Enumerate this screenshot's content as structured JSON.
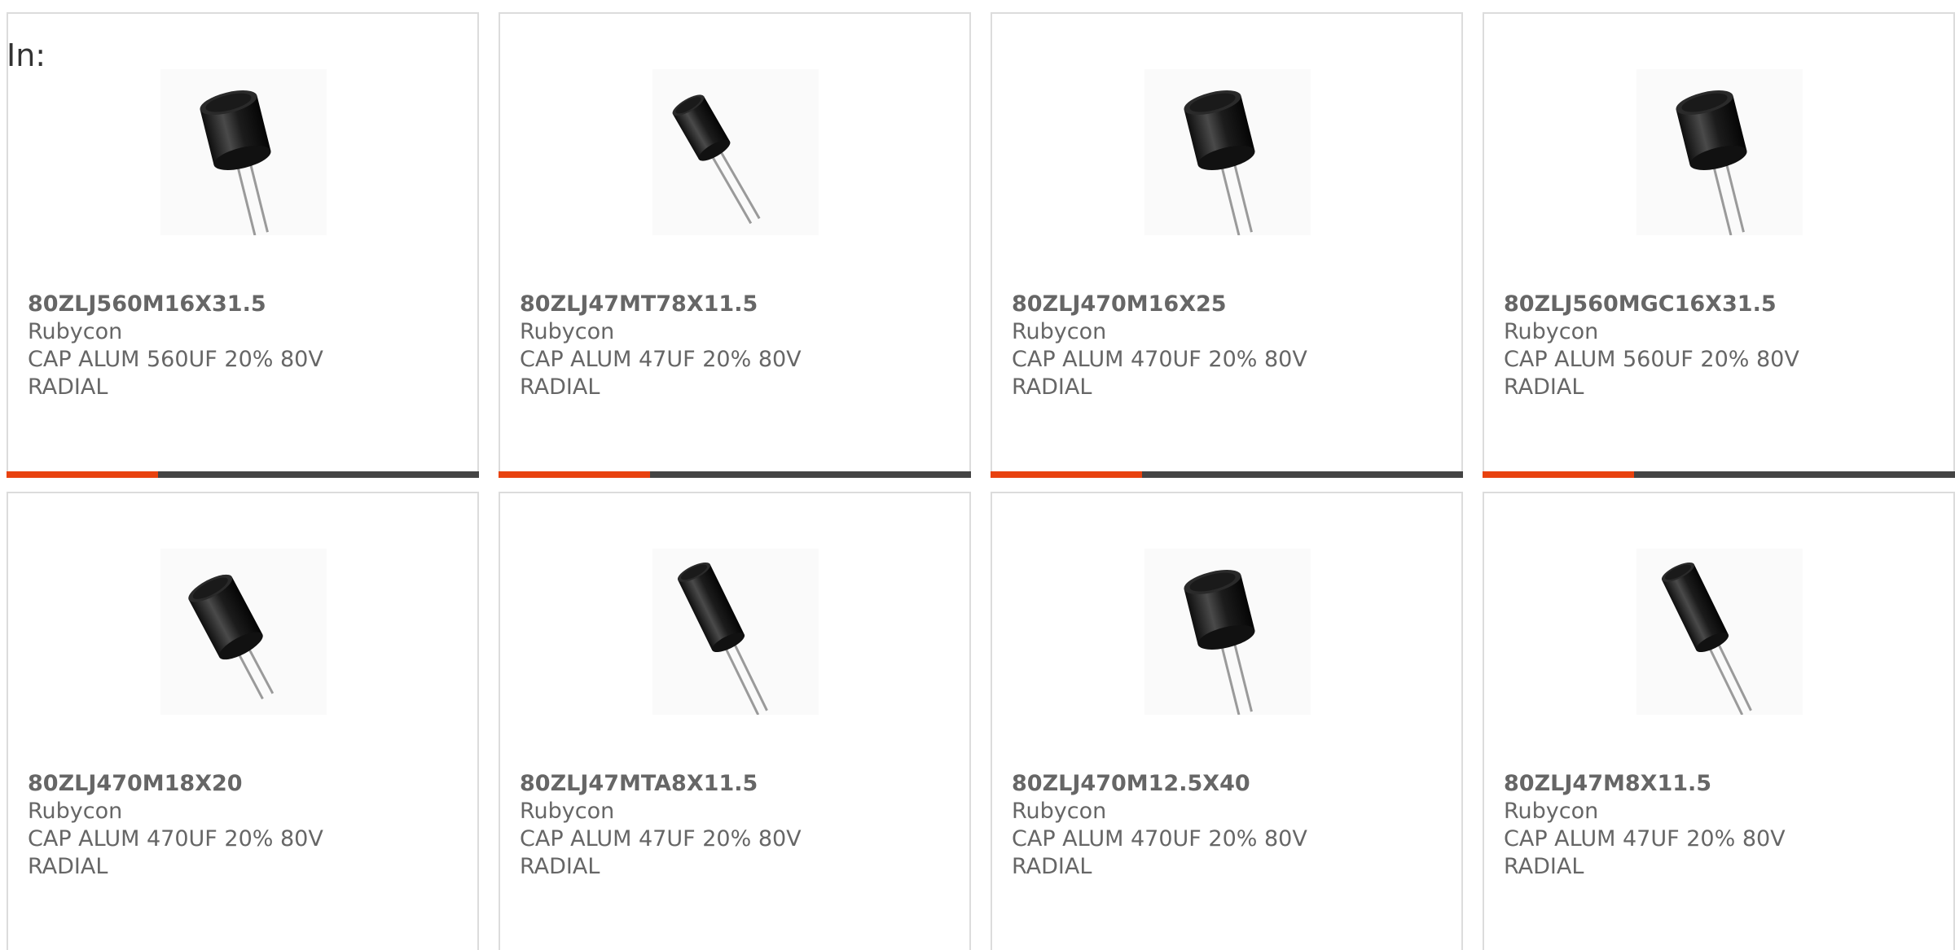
{
  "filter": {
    "label": "In:"
  },
  "accent_color": "#e8420f",
  "products": [
    {
      "part_number": "80ZLJ560M16X31.5",
      "manufacturer": "Rubycon",
      "description": "CAP ALUM 560UF 20% 80V RADIAL",
      "icon": "radial-capacitor-wide",
      "progress_fraction": 0.32
    },
    {
      "part_number": "80ZLJ47MT78X11.5",
      "manufacturer": "Rubycon",
      "description": "CAP ALUM 47UF 20% 80V RADIAL",
      "icon": "radial-capacitor-small",
      "progress_fraction": 0.32
    },
    {
      "part_number": "80ZLJ470M16X25",
      "manufacturer": "Rubycon",
      "description": "CAP ALUM 470UF 20% 80V RADIAL",
      "icon": "radial-capacitor-wide",
      "progress_fraction": 0.32
    },
    {
      "part_number": "80ZLJ560MGC16X31.5",
      "manufacturer": "Rubycon",
      "description": "CAP ALUM 560UF 20% 80V RADIAL",
      "icon": "radial-capacitor-wide",
      "progress_fraction": 0.32
    },
    {
      "part_number": "80ZLJ470M18X20",
      "manufacturer": "Rubycon",
      "description": "CAP ALUM 470UF 20% 80V RADIAL",
      "icon": "radial-capacitor-tall",
      "progress_fraction": null
    },
    {
      "part_number": "80ZLJ47MTA8X11.5",
      "manufacturer": "Rubycon",
      "description": "CAP ALUM 47UF 20% 80V RADIAL",
      "icon": "radial-capacitor-slim",
      "progress_fraction": null
    },
    {
      "part_number": "80ZLJ470M12.5X40",
      "manufacturer": "Rubycon",
      "description": "CAP ALUM 470UF 20% 80V RADIAL",
      "icon": "radial-capacitor-wide",
      "progress_fraction": null
    },
    {
      "part_number": "80ZLJ47M8X11.5",
      "manufacturer": "Rubycon",
      "description": "CAP ALUM 47UF 20% 80V RADIAL",
      "icon": "radial-capacitor-slim",
      "progress_fraction": null
    }
  ]
}
